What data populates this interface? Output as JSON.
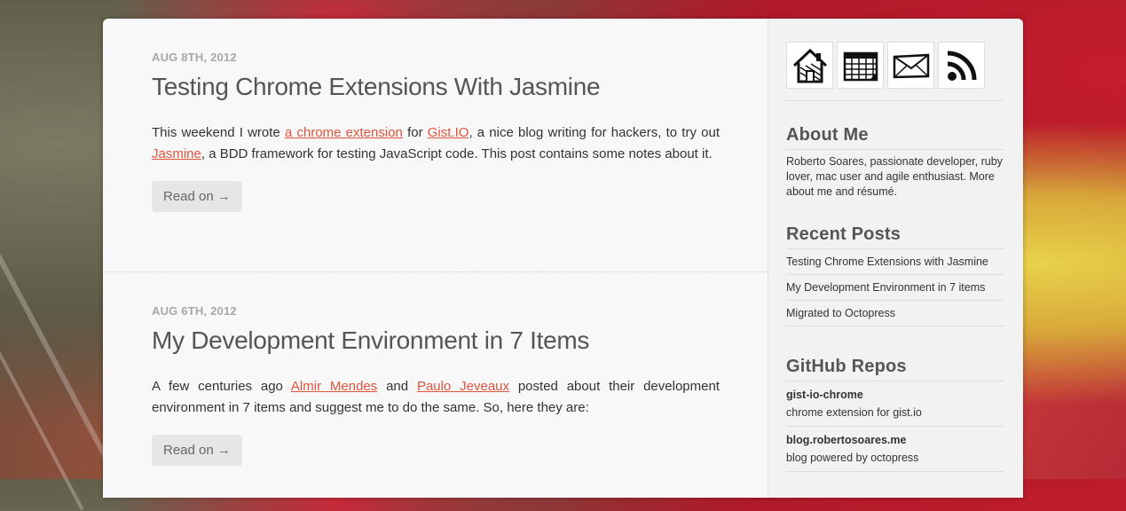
{
  "posts": [
    {
      "date": "AUG 8TH, 2012",
      "title": "Testing Chrome Extensions With Jasmine",
      "body": {
        "t1": "This weekend I wrote ",
        "l1": "a chrome extension",
        "t2": " for ",
        "l2": "Gist.IO",
        "t3": ", a nice blog writing for hackers, to try out ",
        "l3": "Jasmine",
        "t4": ", a BDD framework for testing JavaScript code. This post contains some notes about it."
      },
      "read_on": "Read on →"
    },
    {
      "date": "AUG 6TH, 2012",
      "title": "My Development Environment in 7 Items",
      "body": {
        "t1": "A few centuries ago ",
        "l1": "Almir Mendes",
        "t2": " and ",
        "l2": "Paulo Jeveaux",
        "t3": " posted about their development environment in 7 items and suggest me to do the same. So, here they are:"
      },
      "read_on": "Read on →"
    }
  ],
  "sidebar": {
    "icons": [
      "home-icon",
      "calendar-icon",
      "mail-icon",
      "rss-icon"
    ],
    "about": {
      "heading": "About Me",
      "text": "Roberto Soares, passionate developer, ruby lover, mac user and agile enthusiast. More about me and résumé."
    },
    "recent": {
      "heading": "Recent Posts",
      "items": [
        "Testing Chrome Extensions with Jasmine",
        "My Development Environment in 7 items",
        "Migrated to Octopress"
      ]
    },
    "github": {
      "heading": "GitHub Repos",
      "repos": [
        {
          "name": "gist-io-chrome",
          "desc": "chrome extension for gist.io"
        },
        {
          "name": "blog.robertosoares.me",
          "desc": "blog powered by octopress"
        }
      ]
    }
  },
  "colors": {
    "link": "#e0533d",
    "title": "#555555",
    "date": "#a8a8a8"
  }
}
